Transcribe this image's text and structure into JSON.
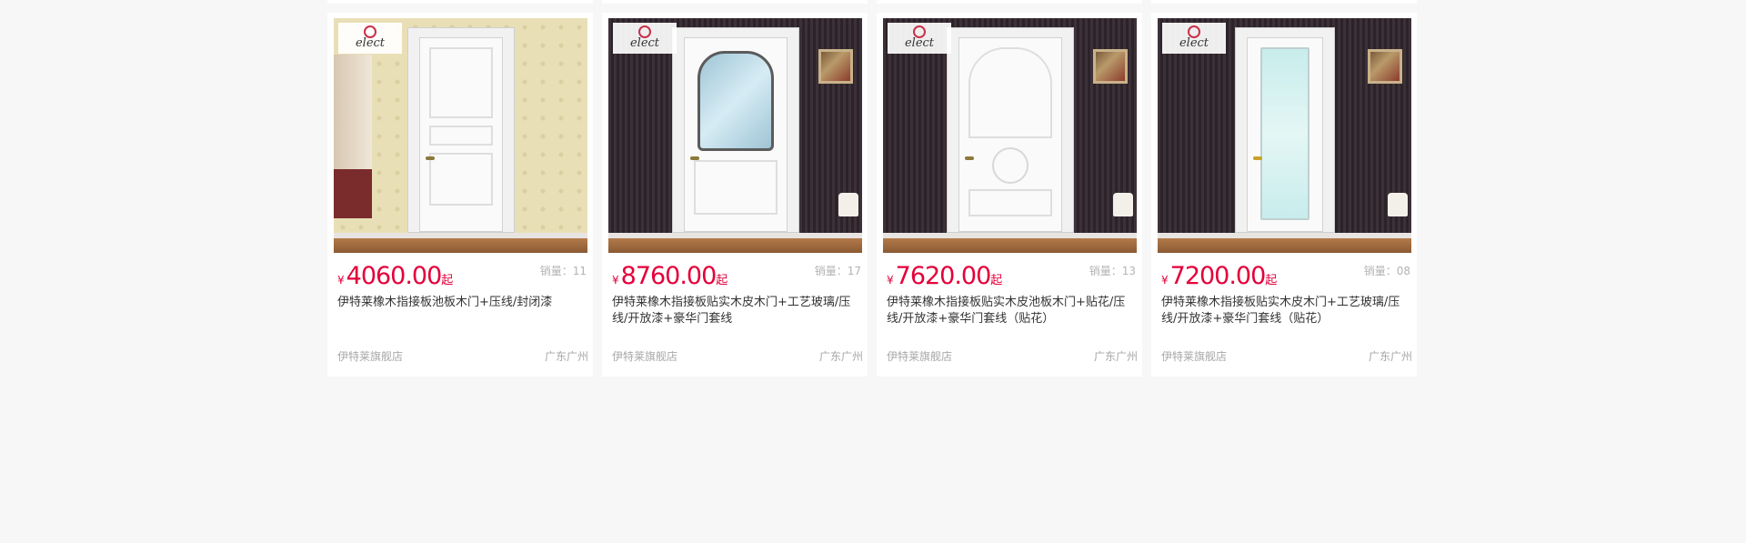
{
  "products": [
    {
      "currency": "¥",
      "price": "4060.00",
      "price_suffix": "起",
      "sales_label": "销量：",
      "sales_value": "11",
      "title": "伊特莱橡木指接板池板木门+压线/封闭漆",
      "shop": "伊特莱旗舰店",
      "location": "广东广州",
      "logo_text": "elect",
      "icon": "product-image-white-panel-door"
    },
    {
      "currency": "¥",
      "price": "8760.00",
      "price_suffix": "起",
      "sales_label": "销量：",
      "sales_value": "17",
      "title": "伊特莱橡木指接板贴实木皮木门+工艺玻璃/压线/开放漆+豪华门套线",
      "shop": "伊特莱旗舰店",
      "location": "广东广州",
      "logo_text": "elect",
      "icon": "product-image-glass-arch-door"
    },
    {
      "currency": "¥",
      "price": "7620.00",
      "price_suffix": "起",
      "sales_label": "销量：",
      "sales_value": "13",
      "title": "伊特莱橡木指接板贴实木皮池板木门+贴花/压线/开放漆+豪华门套线（贴花）",
      "shop": "伊特莱旗舰店",
      "location": "广东广州",
      "logo_text": "elect",
      "icon": "product-image-carved-panel-door"
    },
    {
      "currency": "¥",
      "price": "7200.00",
      "price_suffix": "起",
      "sales_label": "销量：",
      "sales_value": "08",
      "title": "伊特莱橡木指接板贴实木皮木门+工艺玻璃/压线/开放漆+豪华门套线（贴花）",
      "shop": "伊特莱旗舰店",
      "location": "广东广州",
      "logo_text": "elect",
      "icon": "product-image-frosted-glass-door"
    }
  ],
  "colors": {
    "background": "#f7f7f7",
    "card": "#ffffff",
    "price": "#e4003a",
    "title": "#333333",
    "muted": "#a8a8a8"
  }
}
